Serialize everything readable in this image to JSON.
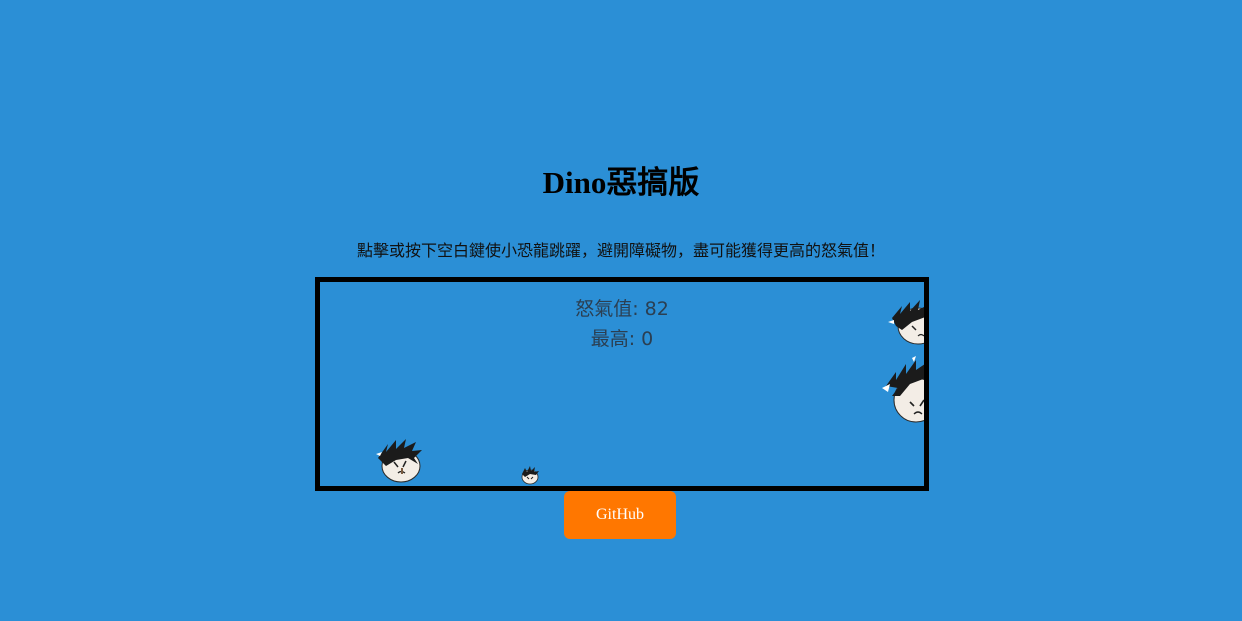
{
  "header": {
    "title": "Dino惡搞版",
    "instructions": "點擊或按下空白鍵使小恐龍跳躍，避開障礙物，盡可能獲得更高的怒氣值！"
  },
  "game": {
    "score_text": "怒氣值: 82",
    "best_text": "最高: 0",
    "score": 82,
    "best": 0,
    "player_icon": "angry-face-icon",
    "obstacle_icon": "angry-face-icon",
    "background_color": "#2b8fd6",
    "border_color": "#000000"
  },
  "footer": {
    "github_label": "GitHub",
    "button_color": "#ff7700"
  }
}
